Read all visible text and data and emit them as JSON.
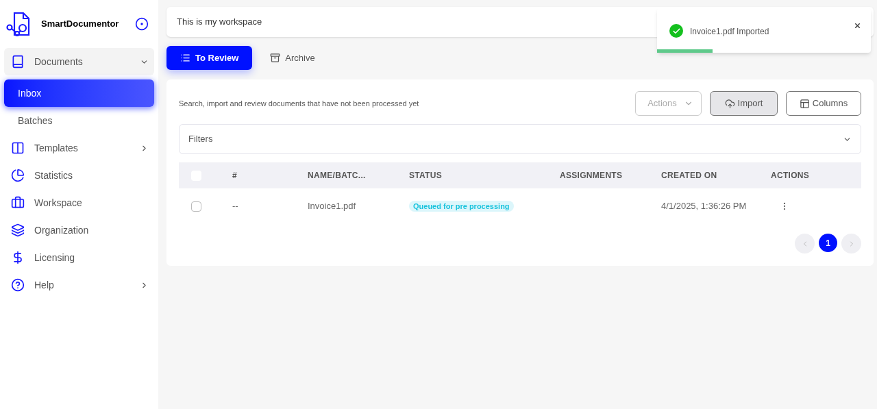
{
  "brand": {
    "name": "SmartDocumentor"
  },
  "sidebar": {
    "items": [
      {
        "label": "Documents",
        "kind": "group",
        "expanded": true,
        "children": [
          {
            "label": "Inbox",
            "selected": true
          },
          {
            "label": "Batches",
            "selected": false
          }
        ]
      },
      {
        "label": "Templates",
        "kind": "group",
        "expanded": false
      },
      {
        "label": "Statistics",
        "kind": "link"
      },
      {
        "label": "Workspace",
        "kind": "link"
      },
      {
        "label": "Organization",
        "kind": "link"
      },
      {
        "label": "Licensing",
        "kind": "link"
      },
      {
        "label": "Help",
        "kind": "group",
        "expanded": false
      }
    ]
  },
  "header": {
    "title": "This is my workspace"
  },
  "tabs": [
    {
      "label": "To Review",
      "selected": true
    },
    {
      "label": "Archive",
      "selected": false
    }
  ],
  "panel": {
    "description": "Search, import and review documents that have not been processed yet",
    "buttons": [
      {
        "label": "Actions",
        "disabled": true
      },
      {
        "label": "Import",
        "disabled": false
      },
      {
        "label": "Columns",
        "disabled": false
      }
    ],
    "filters": {
      "label": "Filters",
      "expanded": false
    }
  },
  "table": {
    "select_all_checked": false,
    "columns": [
      "#",
      "NAME/BATC...",
      "STATUS",
      "ASSIGNMENTS",
      "CREATED ON",
      "ACTIONS"
    ],
    "rows": [
      {
        "checked": false,
        "number": "--",
        "name": "Invoice1.pdf",
        "status": "Queued for pre processing",
        "created_on": "4/1/2025, 1:36:26 PM"
      }
    ]
  },
  "pagination": {
    "pages": [
      {
        "label": "1",
        "selected": true
      }
    ]
  },
  "toast": {
    "message": "Invoice1.pdf Imported",
    "level": 0.26
  }
}
